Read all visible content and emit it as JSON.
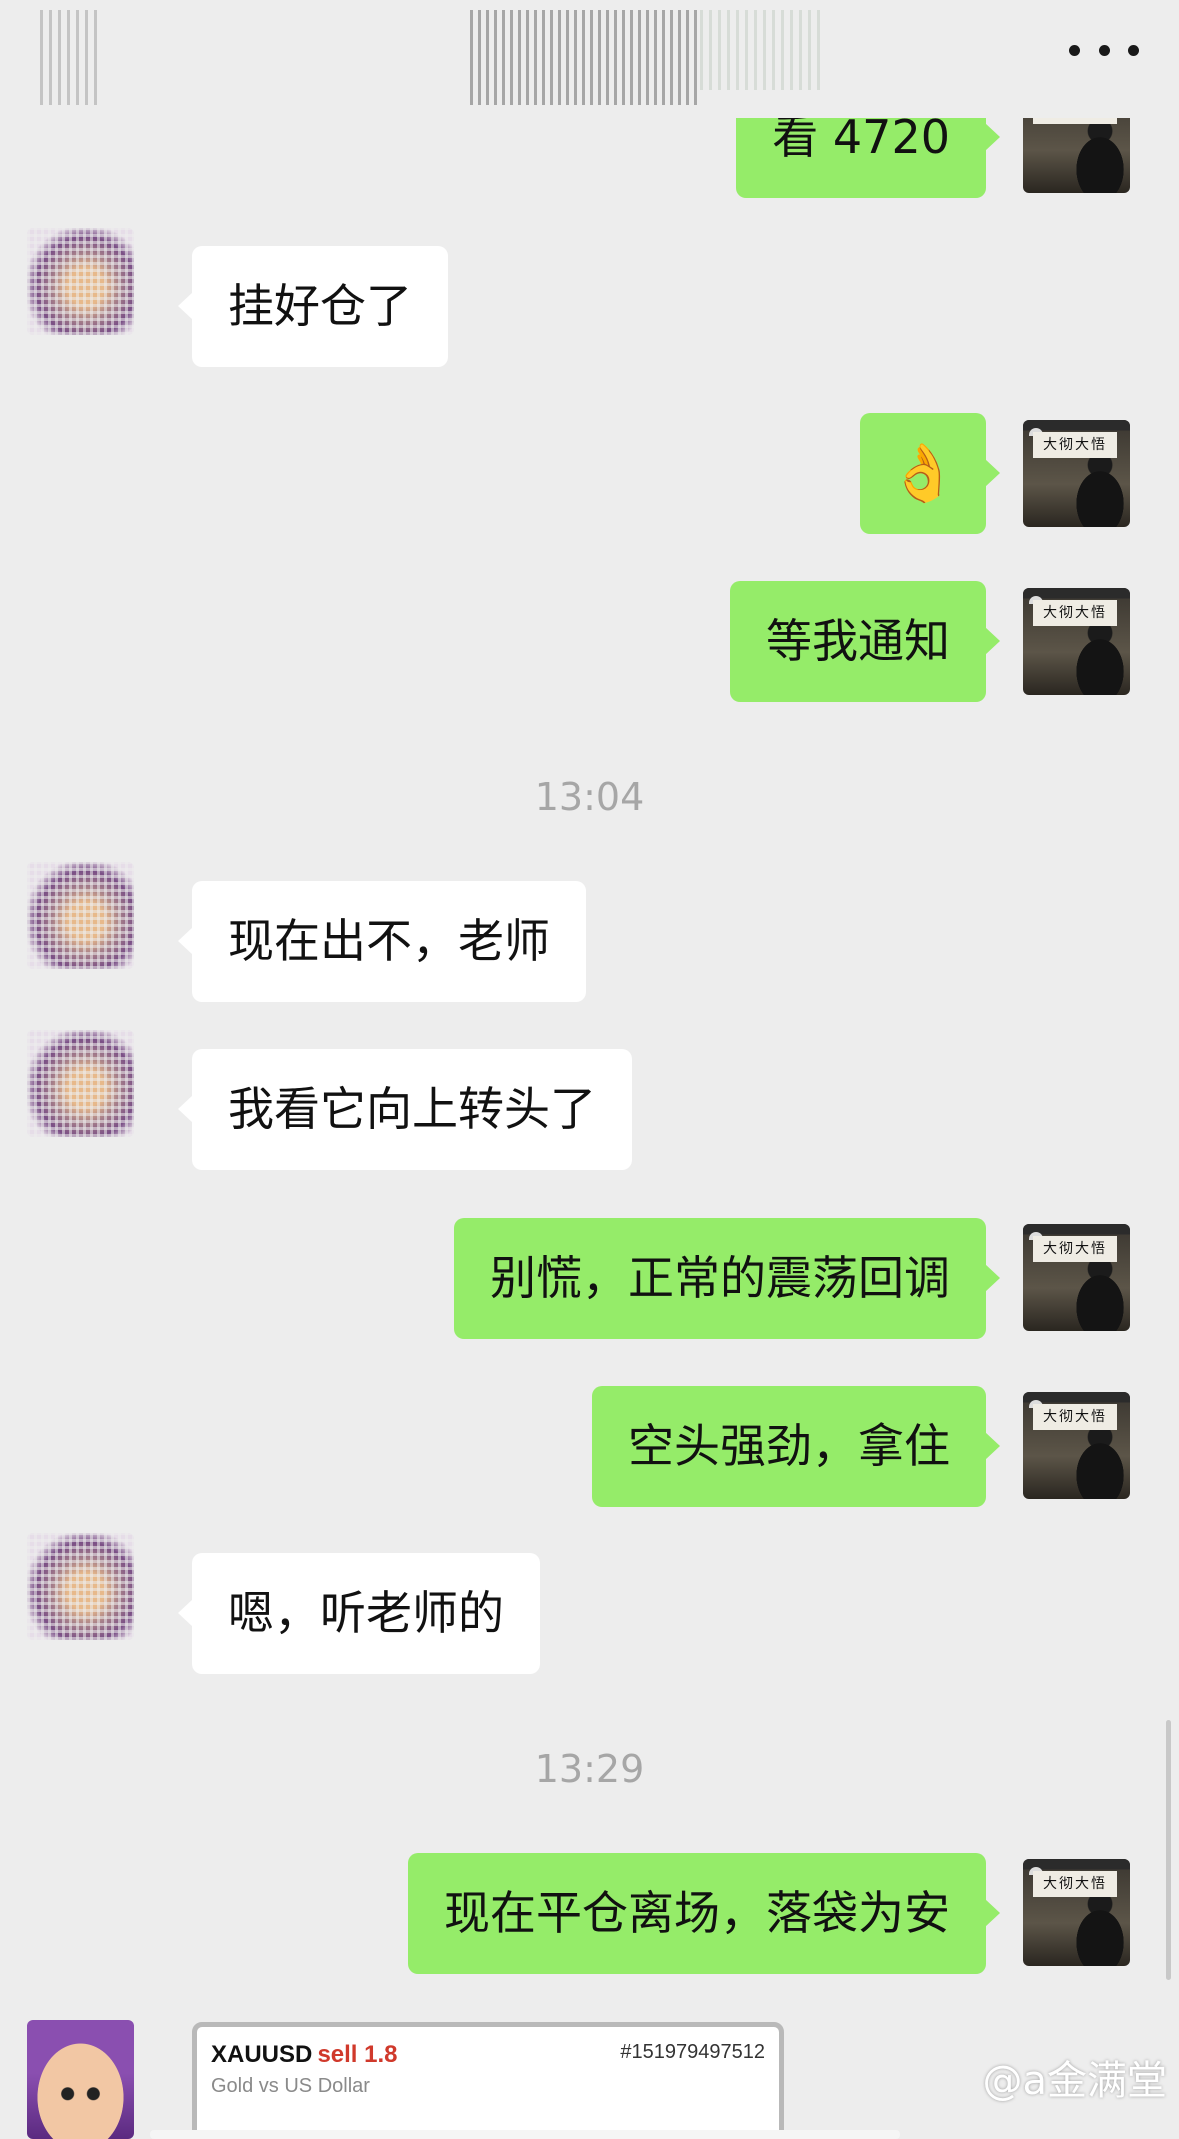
{
  "header": {
    "more_icon": "more-dots-icon"
  },
  "messages": [
    {
      "side": "right",
      "text": "看 4720"
    },
    {
      "side": "left",
      "text": "挂好仓了"
    },
    {
      "side": "right",
      "text": "👌"
    },
    {
      "side": "right",
      "text": "等我通知"
    },
    {
      "side": "left",
      "text": "现在出不，老师"
    },
    {
      "side": "left",
      "text": "我看它向上转头了"
    },
    {
      "side": "right",
      "text": "别慌，正常的震荡回调"
    },
    {
      "side": "right",
      "text": "空头强劲，拿住"
    },
    {
      "side": "left",
      "text": "嗯，听老师的"
    },
    {
      "side": "right",
      "text": "现在平仓离场，落袋为安"
    }
  ],
  "timestamps": [
    "13:04",
    "13:29"
  ],
  "avatar_sign": "大彻大悟",
  "trade_card": {
    "symbol": "XAUUSD",
    "side": "sell 1.8",
    "order_id": "#151979497512",
    "description": "Gold vs US Dollar"
  },
  "watermark": "@a金满堂",
  "colors": {
    "outgoing_bubble": "#95ec69",
    "incoming_bubble": "#ffffff",
    "background": "#ededed",
    "sell": "#d0392b"
  }
}
